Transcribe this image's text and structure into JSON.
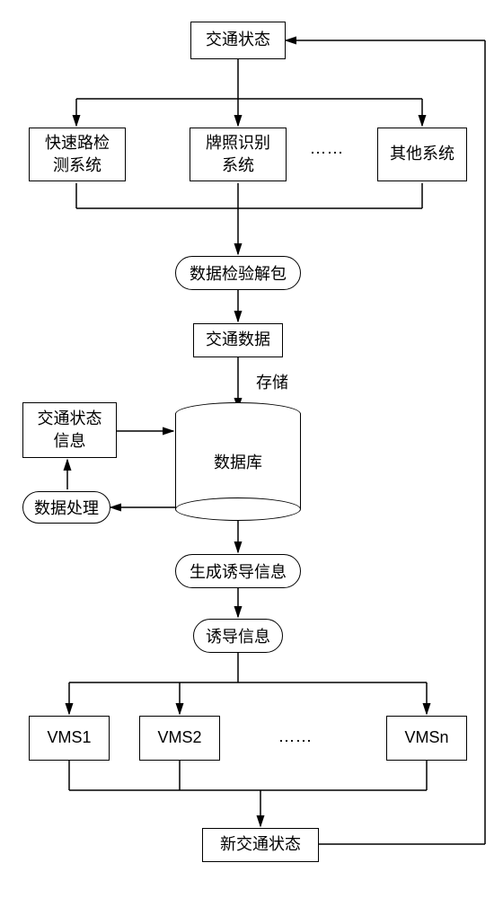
{
  "nodes": {
    "traffic_state": "交通状态",
    "expressway_detection": "快速路检\n测系统",
    "license_recognition": "牌照识别\n系统",
    "other_systems": "其他系统",
    "data_verify_unpack": "数据检验解包",
    "traffic_data": "交通数据",
    "storage_label": "存储",
    "database": "数据库",
    "traffic_state_info": "交通状态\n信息",
    "data_processing": "数据处理",
    "generate_guidance": "生成诱导信息",
    "guidance_info": "诱导信息",
    "vms1": "VMS1",
    "vms2": "VMS2",
    "vmsn": "VMSn",
    "new_traffic_state": "新交通状态",
    "ellipsis1": "⋯⋯",
    "ellipsis2": "⋯⋯"
  },
  "chart_data": {
    "type": "flowchart",
    "nodes": [
      {
        "id": "traffic_state",
        "label": "交通状态",
        "shape": "rect"
      },
      {
        "id": "expressway_detection",
        "label": "快速路检测系统",
        "shape": "rect"
      },
      {
        "id": "license_recognition",
        "label": "牌照识别系统",
        "shape": "rect"
      },
      {
        "id": "other_systems",
        "label": "其他系统",
        "shape": "rect"
      },
      {
        "id": "data_verify_unpack",
        "label": "数据检验解包",
        "shape": "pill"
      },
      {
        "id": "traffic_data",
        "label": "交通数据",
        "shape": "rect"
      },
      {
        "id": "database",
        "label": "数据库",
        "shape": "cylinder"
      },
      {
        "id": "traffic_state_info",
        "label": "交通状态信息",
        "shape": "rect"
      },
      {
        "id": "data_processing",
        "label": "数据处理",
        "shape": "pill"
      },
      {
        "id": "generate_guidance",
        "label": "生成诱导信息",
        "shape": "pill"
      },
      {
        "id": "guidance_info",
        "label": "诱导信息",
        "shape": "pill"
      },
      {
        "id": "vms1",
        "label": "VMS1",
        "shape": "rect"
      },
      {
        "id": "vms2",
        "label": "VMS2",
        "shape": "rect"
      },
      {
        "id": "vmsn",
        "label": "VMSn",
        "shape": "rect"
      },
      {
        "id": "new_traffic_state",
        "label": "新交通状态",
        "shape": "rect"
      }
    ],
    "edges": [
      {
        "from": "traffic_state",
        "to": "expressway_detection"
      },
      {
        "from": "traffic_state",
        "to": "license_recognition"
      },
      {
        "from": "traffic_state",
        "to": "other_systems"
      },
      {
        "from": "expressway_detection",
        "to": "data_verify_unpack"
      },
      {
        "from": "license_recognition",
        "to": "data_verify_unpack"
      },
      {
        "from": "other_systems",
        "to": "data_verify_unpack"
      },
      {
        "from": "data_verify_unpack",
        "to": "traffic_data"
      },
      {
        "from": "traffic_data",
        "to": "database",
        "label": "存储"
      },
      {
        "from": "database",
        "to": "data_processing"
      },
      {
        "from": "data_processing",
        "to": "traffic_state_info"
      },
      {
        "from": "traffic_state_info",
        "to": "database"
      },
      {
        "from": "database",
        "to": "generate_guidance"
      },
      {
        "from": "generate_guidance",
        "to": "guidance_info"
      },
      {
        "from": "guidance_info",
        "to": "vms1"
      },
      {
        "from": "guidance_info",
        "to": "vms2"
      },
      {
        "from": "guidance_info",
        "to": "vmsn"
      },
      {
        "from": "vms1",
        "to": "new_traffic_state"
      },
      {
        "from": "vms2",
        "to": "new_traffic_state"
      },
      {
        "from": "vmsn",
        "to": "new_traffic_state"
      },
      {
        "from": "new_traffic_state",
        "to": "traffic_state",
        "note": "feedback right side"
      }
    ]
  }
}
